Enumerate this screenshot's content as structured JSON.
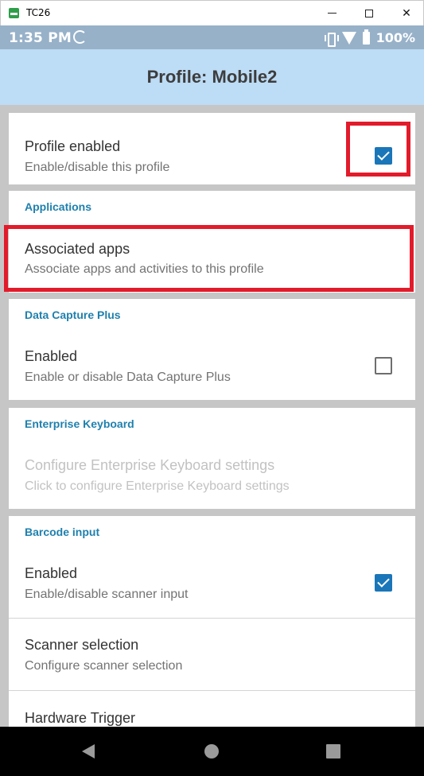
{
  "window": {
    "title": "TC26",
    "minimize_icon": "minimize-icon",
    "maximize_icon": "maximize-icon",
    "close_icon": "close-icon",
    "close_glyph": "✕"
  },
  "status_bar": {
    "time": "1:35 PM",
    "battery": "100%"
  },
  "header": {
    "title": "Profile: Mobile2"
  },
  "profile": {
    "title": "Profile enabled",
    "summary": "Enable/disable this profile",
    "checked": true
  },
  "applications": {
    "category": "Applications",
    "associated_apps": {
      "title": "Associated apps",
      "summary": "Associate apps and activities to this profile"
    }
  },
  "data_capture_plus": {
    "category": "Data Capture Plus",
    "enabled": {
      "title": "Enabled",
      "summary": "Enable or disable Data Capture Plus",
      "checked": false
    }
  },
  "enterprise_keyboard": {
    "category": "Enterprise Keyboard",
    "configure": {
      "title": "Configure Enterprise Keyboard settings",
      "summary": "Click to configure Enterprise Keyboard settings",
      "enabled": false
    }
  },
  "barcode_input": {
    "category": "Barcode input",
    "enabled": {
      "title": "Enabled",
      "summary": "Enable/disable scanner input",
      "checked": true
    },
    "scanner_selection": {
      "title": "Scanner selection",
      "summary": "Configure scanner selection"
    },
    "hardware_trigger": {
      "title": "Hardware Trigger"
    }
  },
  "colors": {
    "status_bar": "#97b1c9",
    "header": "#bddcf5",
    "accent": "#1f80ad",
    "checkbox": "#1a76b8",
    "highlight": "#e21b2b"
  }
}
